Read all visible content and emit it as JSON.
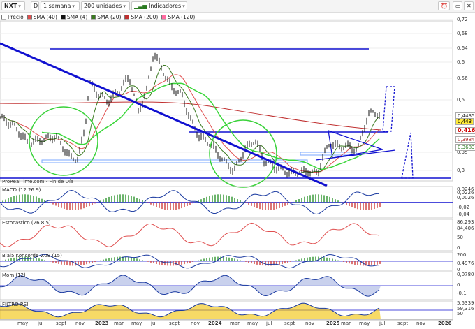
{
  "toolbar": {
    "ticker": "NXT",
    "d_label": "D",
    "period": "1 semana",
    "units": "200 unidades",
    "indicators": "Indicadores"
  },
  "legend": [
    {
      "label": "Precio",
      "color": "#ffffff"
    },
    {
      "label": "SMA (40)",
      "color": "#e05050"
    },
    {
      "label": "SMA (4)",
      "color": "#111111"
    },
    {
      "label": "SMA (20)",
      "color": "#3a7a20"
    },
    {
      "label": "SMA (200)",
      "color": "#c03030"
    },
    {
      "label": "SMA (120)",
      "color": "#ff6aa0"
    }
  ],
  "source_label": "ProRealTime.com - Fin de Día",
  "price_axis": [
    "0,72",
    "0,68",
    "0,64",
    "0,6",
    "0,56",
    "0,5",
    "0,45",
    "0,35",
    "0,3"
  ],
  "price_tags": [
    {
      "text": "0,4435",
      "color": "#333"
    },
    {
      "text": "0,443",
      "color": "#000",
      "bg": "#ffeb3b"
    },
    {
      "text": "0,416",
      "color": "#d00000"
    },
    {
      "text": "0,3984",
      "color": "#b03030"
    },
    {
      "text": "0,3683",
      "color": "#2a7a20"
    }
  ],
  "panels": [
    {
      "title": "MACD (12 26 9)",
      "tags": [
        "0,0246",
        "0,0226",
        "0,0026",
        "-0,02",
        "-0,04"
      ]
    },
    {
      "title": "Estocástico (26 8 5)",
      "tags": [
        "86,293",
        "84,406",
        "50",
        "0"
      ]
    },
    {
      "title": "Blai5 Koncorde v.09 (15)",
      "tags": [
        "200",
        "0,4976",
        "0"
      ]
    },
    {
      "title": "Mom (12)",
      "tags": [
        "0,0780",
        "0",
        "-0,1"
      ]
    },
    {
      "title": "FILTRO RSI",
      "tags": [
        "5,5339",
        "59,316",
        "50"
      ]
    }
  ],
  "x_axis": [
    {
      "label": "may",
      "year": false
    },
    {
      "label": "jul",
      "year": false
    },
    {
      "label": "sept",
      "year": false
    },
    {
      "label": "nov",
      "year": false
    },
    {
      "label": "2023",
      "year": true
    },
    {
      "label": "mar",
      "year": false
    },
    {
      "label": "may",
      "year": false
    },
    {
      "label": "jul",
      "year": false
    },
    {
      "label": "sept",
      "year": false
    },
    {
      "label": "nov",
      "year": false
    },
    {
      "label": "2024",
      "year": true
    },
    {
      "label": "mar",
      "year": false
    },
    {
      "label": "may",
      "year": false
    },
    {
      "label": "jul",
      "year": false
    },
    {
      "label": "sept",
      "year": false
    },
    {
      "label": "nov",
      "year": false
    },
    {
      "label": "2025",
      "year": true
    },
    {
      "label": "mar",
      "year": false
    },
    {
      "label": "may",
      "year": false
    },
    {
      "label": "jul",
      "year": false
    },
    {
      "label": "sept",
      "year": false
    },
    {
      "label": "nov",
      "year": false
    },
    {
      "label": "2026",
      "year": true
    }
  ],
  "colors": {
    "trend": "#1010d0",
    "circle": "#3ad23a",
    "sma40": "#e05050",
    "sma20": "#3a7a20",
    "sma200": "#c03030"
  }
}
